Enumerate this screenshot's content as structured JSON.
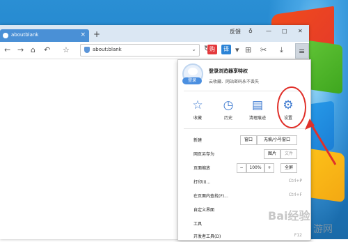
{
  "tab": {
    "title": "aboutblank"
  },
  "window_controls": {
    "feedback": "反馈",
    "skin": "♁",
    "minimize": "—",
    "maximize": "□",
    "close": "✕"
  },
  "address": {
    "url": "about:blank"
  },
  "extensions": [
    {
      "label": "购",
      "color": "#e4393c"
    },
    {
      "label": "译",
      "color": "#2b83d6"
    }
  ],
  "menu": {
    "user_title": "登录浏览器享特权",
    "user_sub": "云收藏、网站密码永不丢失",
    "login_badge": "登录",
    "quick": [
      {
        "icon": "☆",
        "label": "收藏",
        "name": "favorites"
      },
      {
        "icon": "◷",
        "label": "历史",
        "name": "history"
      },
      {
        "icon": "▤",
        "label": "清理痕迹",
        "name": "clear-traces"
      },
      {
        "icon": "⚙",
        "label": "设置",
        "name": "settings"
      }
    ],
    "new_label": "新建",
    "new_window": "窗口",
    "new_incognito": "无痕/小号窗口",
    "save_label": "网页另存为",
    "save_image": "图片",
    "save_file": "文件",
    "zoom_label": "页面缩放",
    "zoom_minus": "−",
    "zoom_value": "100%",
    "zoom_plus": "+",
    "zoom_full": "全屏",
    "print_label": "打印(I)...",
    "print_shortcut": "Ctrl+P",
    "find_label": "在页面内查找(F)...",
    "find_shortcut": "Ctrl+F",
    "custom_label": "自定义界面",
    "tools_label": "工具",
    "devtools_label": "开发者工具(D)",
    "devtools_shortcut": "F12"
  },
  "watermark": {
    "top": "Bai经验",
    "bottom": "游网"
  }
}
